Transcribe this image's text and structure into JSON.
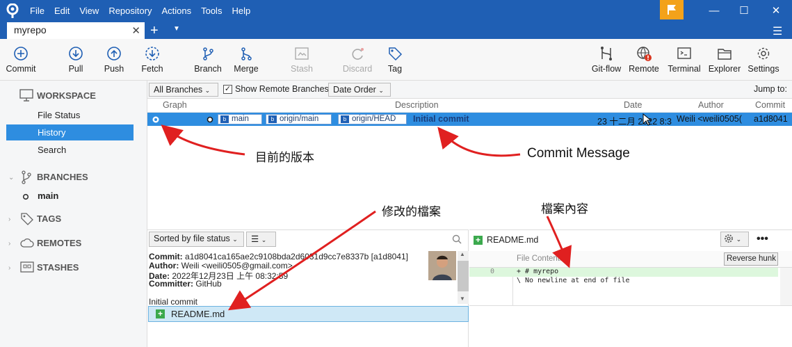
{
  "app": {
    "menu": [
      "File",
      "Edit",
      "View",
      "Repository",
      "Actions",
      "Tools",
      "Help"
    ],
    "tab": "myrepo"
  },
  "toolbar": {
    "left": [
      "Commit",
      "Pull",
      "Push",
      "Fetch",
      "Branch",
      "Merge",
      "Stash",
      "Discard",
      "Tag"
    ],
    "right": [
      "Git-flow",
      "Remote",
      "Terminal",
      "Explorer",
      "Settings"
    ]
  },
  "sidebar": {
    "workspace": "WORKSPACE",
    "items": [
      "File Status",
      "History",
      "Search"
    ],
    "branches": "BRANCHES",
    "branch_main": "main",
    "tags": "TAGS",
    "remotes": "REMOTES",
    "stashes": "STASHES"
  },
  "filters": {
    "branches": "All Branches",
    "show_remote": "Show Remote Branches",
    "order": "Date Order",
    "jump": "Jump to:"
  },
  "columns": [
    "Graph",
    "Description",
    "Date",
    "Author",
    "Commit"
  ],
  "commit_row": {
    "branches": [
      "main",
      "origin/main",
      "origin/HEAD"
    ],
    "message": "Initial commit",
    "date": "23 十二月 2022 8:3",
    "author": "Weili <weili0505(",
    "hash": "a1d8041"
  },
  "details": {
    "sort": "Sorted by file status",
    "commit_label": "Commit:",
    "commit_value": "a1d8041ca165ae2c9108bda2d6031d9cc7e8337b [a1d8041]",
    "author_label": "Author:",
    "author_value": "Weili <weili0505@gmail.com>",
    "date_label": "Date:",
    "date_value": "2022年12月23日 上午 08:32:59",
    "committer_label": "Committer:",
    "committer_value": "GitHub",
    "message": "Initial commit",
    "file": "README.md"
  },
  "diff": {
    "file": "README.md",
    "header": "File Contents",
    "reverse": "Reverse hunk",
    "line_no": "0",
    "line1": "+ # myrepo",
    "line2": "\\  No newline at end of file"
  },
  "annotations": {
    "current_version": "目前的版本",
    "commit_message": "Commit Message",
    "modified_files": "修改的檔案",
    "file_contents": "檔案內容"
  },
  "colors": {
    "titlebar": "#1f5fb4",
    "selection": "#2e8de0",
    "annotation_arrow": "#e02020",
    "flag": "#f3a21a"
  }
}
